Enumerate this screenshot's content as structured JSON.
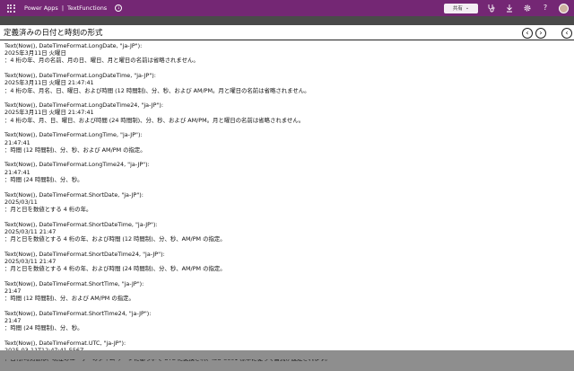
{
  "topbar": {
    "app_name": "Power Apps",
    "separator": "|",
    "app_title": "TextFunctions",
    "share_label": "共有",
    "icons": [
      "waffle-icon",
      "info-icon",
      "chevron-down-icon",
      "stethoscope-icon",
      "download-icon",
      "gear-icon",
      "help-icon",
      "avatar"
    ]
  },
  "screen": {
    "title": "定義済みの日付と時刻の形式",
    "nav": {
      "prev": "‹",
      "next": "›",
      "back": "‹"
    },
    "entries": [
      {
        "formula": "Text(Now(), DateTimeFormat.LongDate, \"ja-JP\"):",
        "result": "2025年3月11日 火曜日",
        "desc": "：4 桁の年、月の名前、月の日、曜日、月と曜日の名前は省略されません。"
      },
      {
        "formula": "Text(Now(), DateTimeFormat.LongDateTime, \"ja-JP\"):",
        "result": "2025年3月11日 火曜日 21:47:41",
        "desc": "：4 桁の年、月名、日、曜日、および時間 (12 時間制)、分、秒、および AM/PM。月と曜日の名前は省略されません。"
      },
      {
        "formula": "Text(Now(), DateTimeFormat.LongDateTime24, \"ja-JP\"):",
        "result": "2025年3月11日 火曜日 21:47:41",
        "desc": "：4 桁の年、月、日、曜日、および時間 (24 時間制)、分、秒、および AM/PM。月と曜日の名前は省略されません。"
      },
      {
        "formula": "Text(Now(), DateTimeFormat.LongTime, \"ja-JP\"):",
        "result": "21:47:41",
        "desc": "：時間 (12 時間制)、分、秒、および AM/PM の指定。"
      },
      {
        "formula": "Text(Now(), DateTimeFormat.LongTime24, \"ja-JP\"):",
        "result": "21:47:41",
        "desc": "：時間 (24 時間制)、分、秒。"
      },
      {
        "formula": "Text(Now(), DateTimeFormat.ShortDate, \"ja-JP\"):",
        "result": "2025/03/11",
        "desc": "：月と日を数値とする 4 桁の年。"
      },
      {
        "formula": "Text(Now(), DateTimeFormat.ShortDateTime, \"ja-JP\"):",
        "result": "2025/03/11 21:47",
        "desc": "：月と日を数値とする 4 桁の年、および時間 (12 時間制)、分、秒、AM/PM の指定。"
      },
      {
        "formula": "Text(Now(), DateTimeFormat.ShortDateTime24, \"ja-JP\"):",
        "result": "2025/03/11 21:47",
        "desc": "：月と日を数値とする 4 桁の年、および時間 (24 時間制)、分、秒、AM/PM の指定。"
      },
      {
        "formula": "Text(Now(), DateTimeFormat.ShortTime, \"ja-JP\"):",
        "result": "21:47",
        "desc": "：時間 (12 時間制)、分、および AM/PM の指定。"
      },
      {
        "formula": "Text(Now(), DateTimeFormat.ShortTime24, \"ja-JP\"):",
        "result": "21:47",
        "desc": "：時間 (24 時間制)、分、秒。"
      },
      {
        "formula": "Text(Now(), DateTimeFormat.UTC, \"ja-JP\"):",
        "result": "2025-03-11T12:47:41.556Z",
        "desc": "：日付/時刻値は、現在のユーザーのタイム ゾーンに基づいて UTC に変換され、ISO 8601 標準に従って書式が設定されます。"
      }
    ]
  }
}
